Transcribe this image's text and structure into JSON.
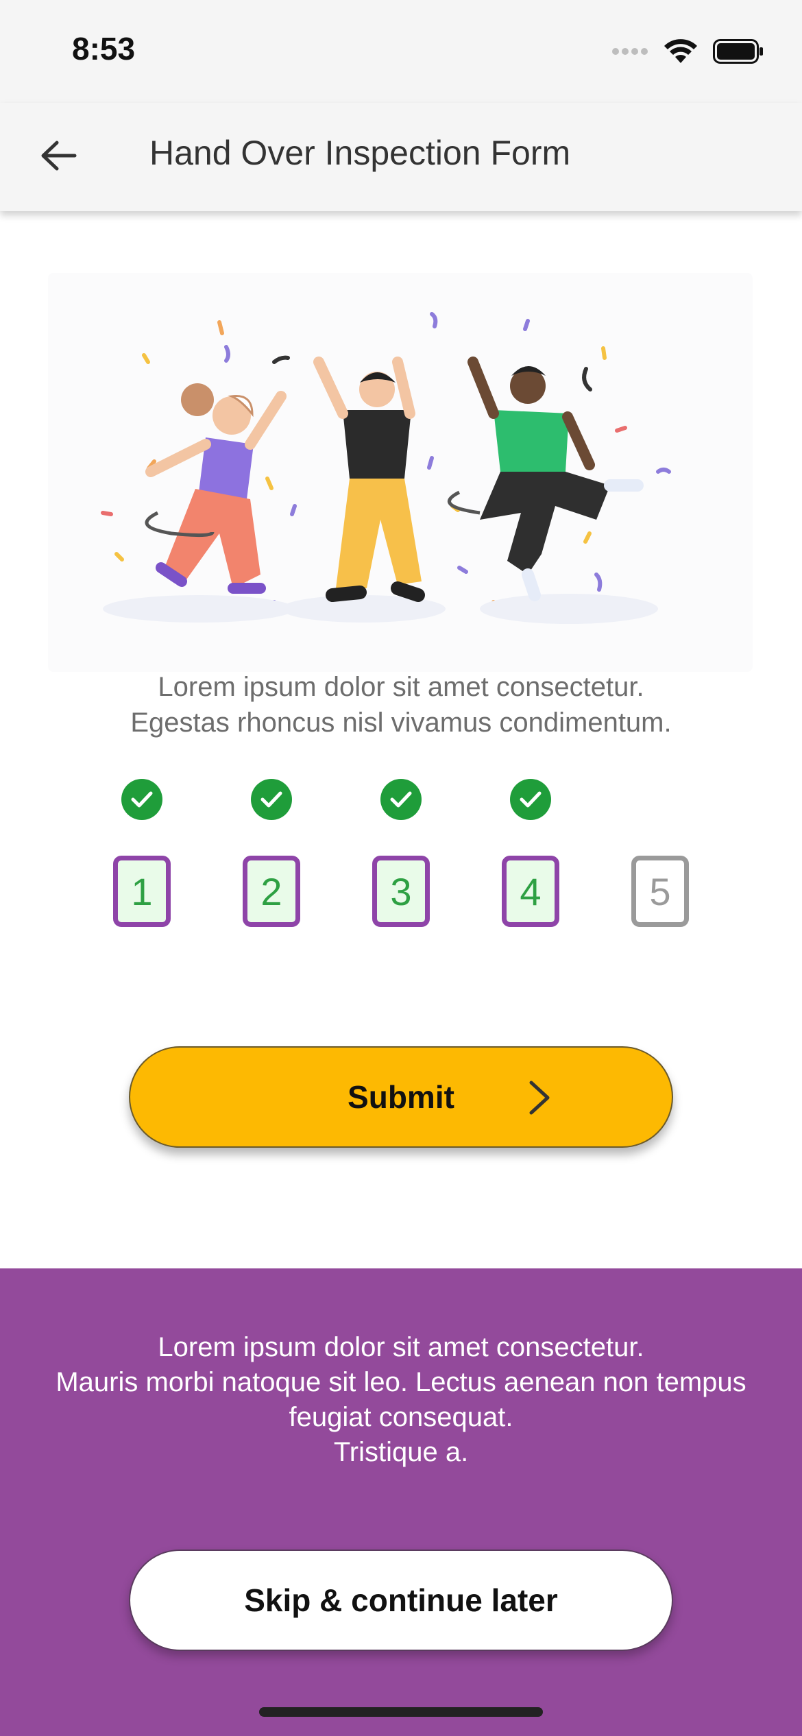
{
  "status_bar": {
    "time": "8:53"
  },
  "app_bar": {
    "title": "Hand Over Inspection Form",
    "back_icon": "arrow-left-icon"
  },
  "hero": {
    "illustration": "celebrating-people-illustration"
  },
  "intro": {
    "lines": [
      "Lorem ipsum dolor sit amet consectetur.",
      "Egestas rhoncus nisl vivamus condimentum."
    ]
  },
  "steps": [
    {
      "number": "1",
      "completed": true
    },
    {
      "number": "2",
      "completed": true
    },
    {
      "number": "3",
      "completed": true
    },
    {
      "number": "4",
      "completed": true
    },
    {
      "number": "5",
      "completed": false
    }
  ],
  "submit": {
    "label": "Submit",
    "icon": "chevron-right-icon"
  },
  "footer": {
    "lines": [
      "Lorem ipsum dolor sit amet consectetur.",
      "Mauris morbi natoque sit leo. Lectus aenean non tempus feugiat consequat.",
      "Tristique a."
    ],
    "skip_label": "Skip & continue later"
  },
  "colors": {
    "accent_purple": "#934a9b",
    "submit_yellow": "#fdb902",
    "success_green": "#1f9d3a"
  }
}
